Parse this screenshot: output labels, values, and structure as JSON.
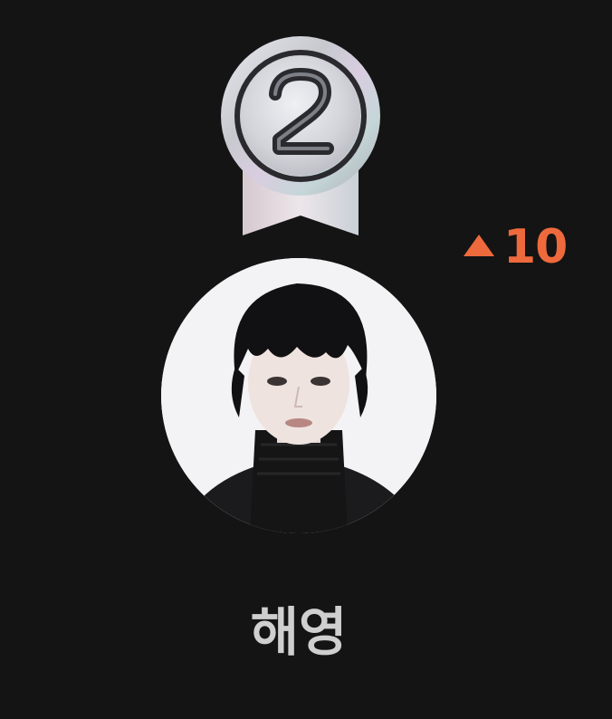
{
  "rank": {
    "position": "2",
    "medal": "silver-medal-icon",
    "change_direction": "up",
    "change_value": "10"
  },
  "user": {
    "name": "해영",
    "avatar": "user-avatar-portrait"
  },
  "colors": {
    "background": "#141414",
    "accent_up": "#ee6a3c",
    "name_text": "#cfcfcf",
    "medal_silver": "#c9cbd1"
  }
}
